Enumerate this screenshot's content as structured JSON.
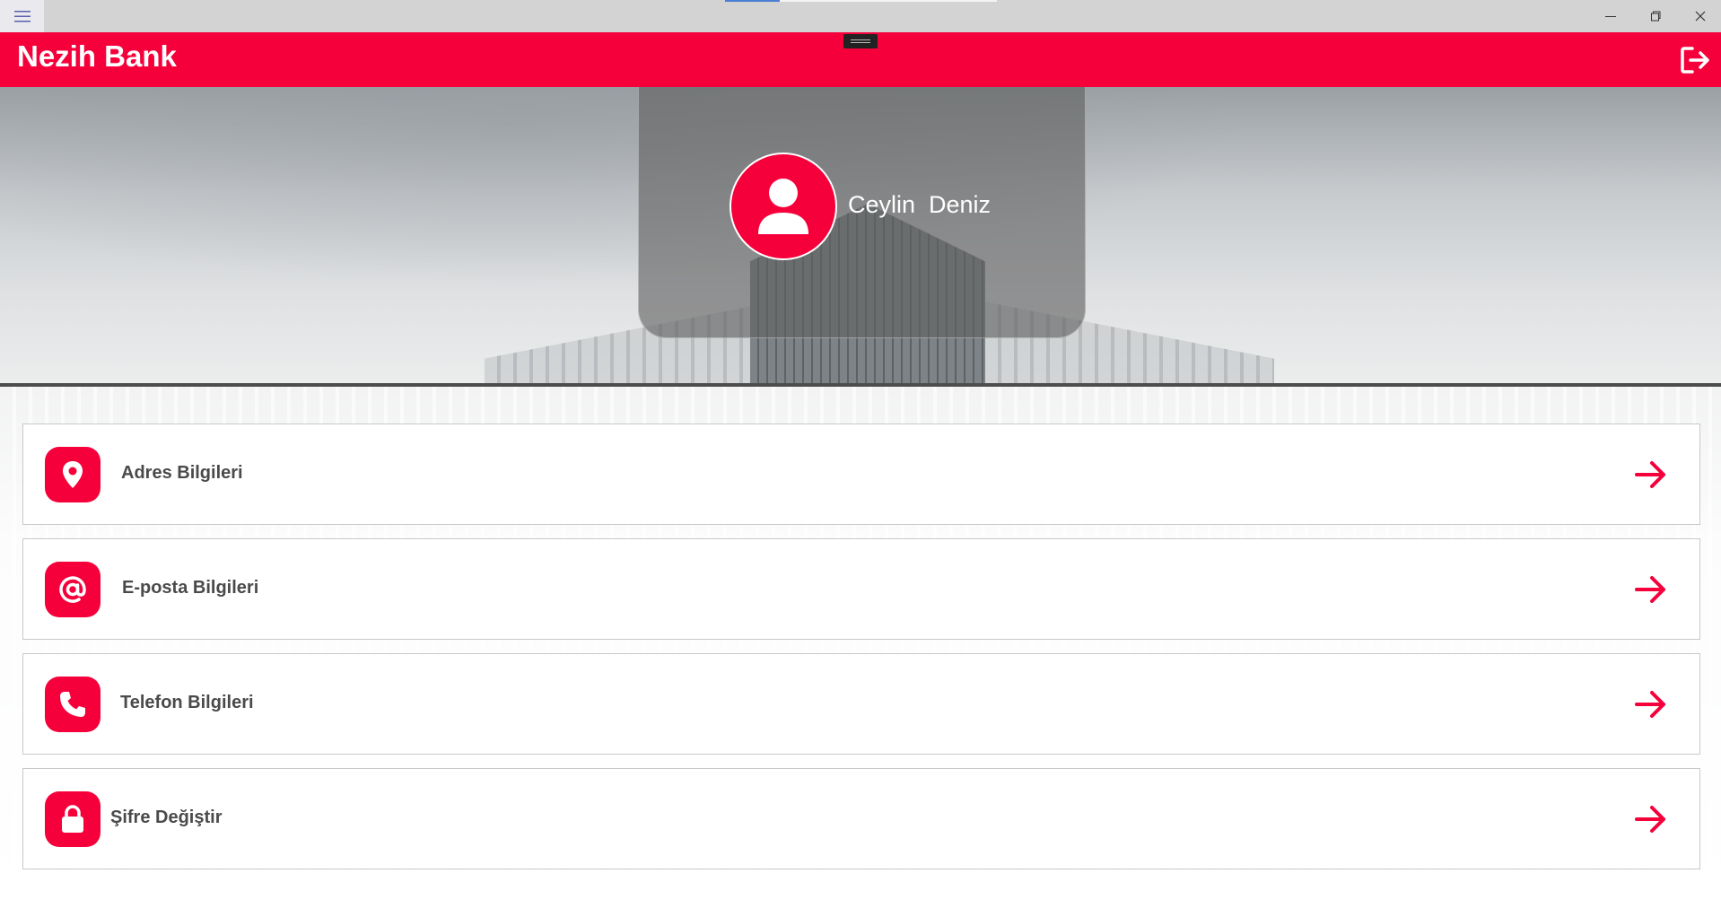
{
  "window": {
    "menu_icon": "hamburger-icon",
    "controls": [
      "minimize-icon",
      "maximize-icon",
      "close-icon"
    ]
  },
  "app": {
    "brand": "Nezih Bank",
    "logout_icon": "logout-icon",
    "accent_color": "#f5003a"
  },
  "profile": {
    "name": "Ceylin  Deniz",
    "avatar_icon": "user-icon"
  },
  "menu": {
    "items": [
      {
        "label": "Adres Bilgileri",
        "icon": "location-pin-icon"
      },
      {
        "label": "E-posta Bilgileri",
        "icon": "at-sign-icon"
      },
      {
        "label": "Telefon Bilgileri",
        "icon": "phone-icon"
      },
      {
        "label": "Şifre Değiştir",
        "icon": "lock-icon"
      }
    ],
    "arrow_icon": "arrow-right-icon"
  }
}
